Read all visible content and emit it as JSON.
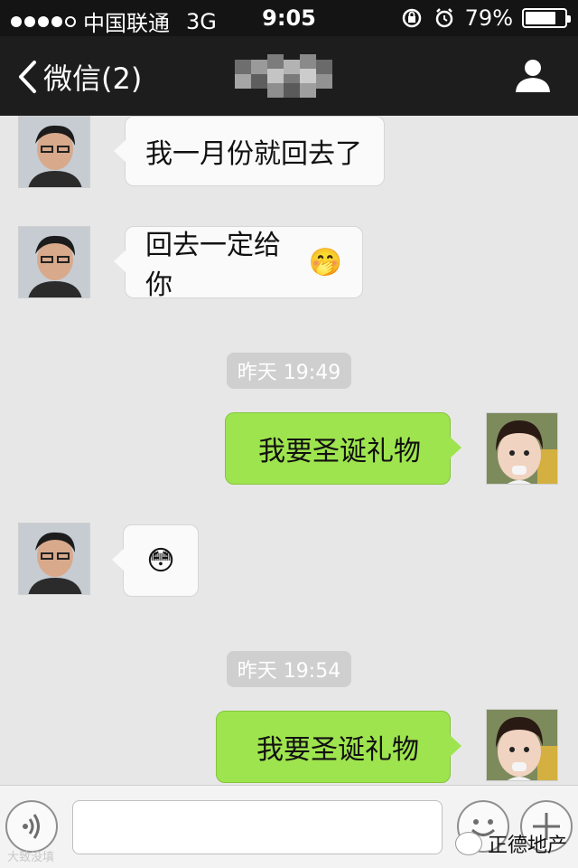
{
  "status_bar": {
    "carrier": "中国联通",
    "network": "3G",
    "time": "9:05",
    "battery": "79%",
    "battery_level": 0.79
  },
  "nav": {
    "back_label": "微信(2)",
    "contact_icon": "person-icon"
  },
  "messages": [
    {
      "side": "in",
      "text": "我一月份就回去了"
    },
    {
      "side": "in",
      "text": "回去一定给你",
      "emoji": "🤭"
    },
    {
      "timestamp": "昨天 19:49"
    },
    {
      "side": "out",
      "text": "我要圣诞礼物"
    },
    {
      "side": "in",
      "emoji": "😳"
    },
    {
      "timestamp": "昨天 19:54"
    },
    {
      "side": "out",
      "text": "我要圣诞礼物"
    }
  ],
  "input_bar": {
    "voice_icon": "voice-icon",
    "emoji_icon": "emoji-icon",
    "more_icon": "plus-icon"
  },
  "watermark": {
    "brand": "正德地产",
    "left_text": "大致没填"
  },
  "colors": {
    "outgoing_bubble": "#9ee44e",
    "incoming_bubble": "#fafafa",
    "nav_background": "#1d1d1d"
  }
}
